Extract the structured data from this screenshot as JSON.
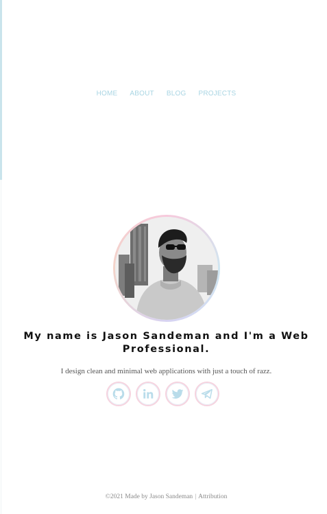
{
  "nav": {
    "items": [
      {
        "label": "HOME"
      },
      {
        "label": "ABOUT"
      },
      {
        "label": "BLOG"
      },
      {
        "label": "PROJECTS"
      }
    ]
  },
  "hero": {
    "headline_line1": "My name is Jason Sandeman and I'm a Web",
    "headline_line2": "Professional.",
    "tagline": "I design clean and minimal web applications with just a touch of razz."
  },
  "socials": [
    {
      "icon": "github-icon"
    },
    {
      "icon": "linkedin-icon"
    },
    {
      "icon": "twitter-icon"
    },
    {
      "icon": "telegram-icon"
    }
  ],
  "footer": {
    "made_by": "©2021 Made by Jason Sandeman",
    "separator": "|",
    "attribution": "Attribution"
  },
  "colors": {
    "nav_link": "#a9d5e3",
    "social_ring": "#f6d3df",
    "social_icon": "#b9dcea",
    "left_accent": "#c9e4ec"
  }
}
